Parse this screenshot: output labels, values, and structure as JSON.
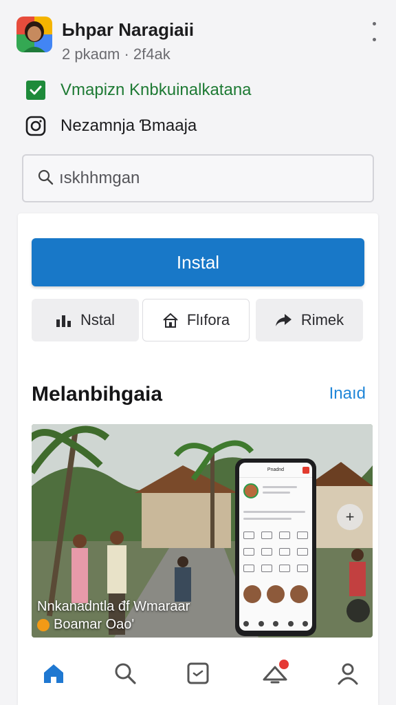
{
  "header": {
    "title": "Ьhpar Naragiaii",
    "subtitle": "2 pkaɑm · 2f4ak",
    "verified_text": "Vmapizn Knbkuinalkatana",
    "instagram_text": "Nezamnja Ɓmaaja"
  },
  "search": {
    "placeholder": "ıskhhmgan"
  },
  "actions": {
    "install_label": "Instal",
    "secondary_1": "Nstal",
    "secondary_2": "Flıfora",
    "secondary_3": "Rimek"
  },
  "section": {
    "title": "Melanbihgaia",
    "link": "Inaıd"
  },
  "feature": {
    "caption_line_1": "Nnkanadntla đf Wmaraar",
    "caption_line_2": "Boamar Oao'",
    "phone_header": "Pnadnd",
    "plus_symbol": "+"
  },
  "colors": {
    "primary": "#1878c8",
    "verified_green": "#1e7a34",
    "link_blue": "#1f86d8",
    "badge_red": "#e53935"
  },
  "icons": {
    "verified": "check-box-icon",
    "instagram": "instagram-icon",
    "search": "search-icon",
    "chart": "bar-chart-icon",
    "home": "home-icon",
    "share": "share-arrow-icon",
    "nav_home": "home-icon",
    "nav_search": "search-icon",
    "nav_square": "reels-icon",
    "nav_bell": "notification-icon",
    "nav_profile": "profile-icon"
  }
}
